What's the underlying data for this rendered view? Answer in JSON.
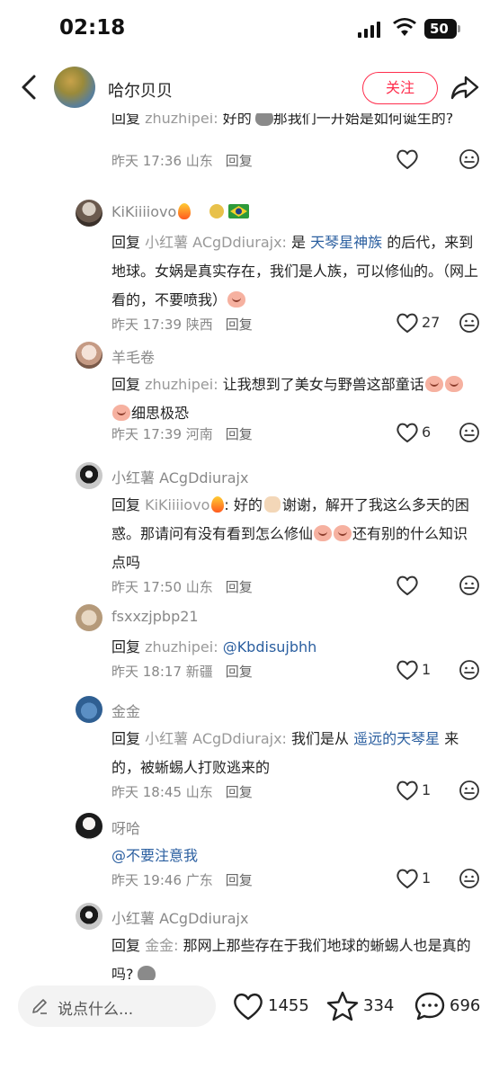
{
  "status_bar": {
    "time": "02:18",
    "battery": "50"
  },
  "header": {
    "title": "哈尔贝贝",
    "follow_label": "关注"
  },
  "comments": [
    {
      "continuation": true,
      "text_parts": [
        {
          "t": "回复 ",
          "c": ""
        },
        {
          "t": "zhuzhipei: ",
          "c": "at"
        },
        {
          "t": "好的",
          "c": ""
        },
        {
          "t": "那我们一开始是如何诞生的?",
          "c": ""
        }
      ],
      "time": "昨天 17:36",
      "location": "山东",
      "reply": "回复",
      "likes": ""
    },
    {
      "user": "KiKiiiiovo",
      "text_parts": [
        {
          "t": "回复 ",
          "c": ""
        },
        {
          "t": "小红薯 ACgDdiurajx: ",
          "c": "at"
        },
        {
          "t": "是 ",
          "c": ""
        },
        {
          "t": "天琴星神族",
          "c": "link"
        },
        {
          "t": " 的后代，来到地球。女娲是真实存在，我们是人族，可以修仙的。（网上看的，不要喷我）",
          "c": ""
        }
      ],
      "time": "昨天 17:39",
      "location": "陕西",
      "reply": "回复",
      "likes": "27"
    },
    {
      "user": "羊毛卷",
      "text_parts": [
        {
          "t": "回复 ",
          "c": ""
        },
        {
          "t": "zhuzhipei: ",
          "c": "at"
        },
        {
          "t": "让我想到了美女与野兽这部童话",
          "c": ""
        },
        {
          "t": "细思极恐",
          "c": ""
        }
      ],
      "time": "昨天 17:39",
      "location": "河南",
      "reply": "回复",
      "likes": "6"
    },
    {
      "user": "小红薯 ACgDdiurajx",
      "text_parts": [
        {
          "t": "回复 ",
          "c": ""
        },
        {
          "t": "KiKiiiiovo",
          "c": "at"
        },
        {
          "t": ": 好的",
          "c": ""
        },
        {
          "t": "谢谢，解开了我这么多天的困惑。那请问有没有看到怎么修仙",
          "c": ""
        },
        {
          "t": "还有别的什么知识点吗",
          "c": ""
        }
      ],
      "time": "昨天 17:50",
      "location": "山东",
      "reply": "回复",
      "likes": ""
    },
    {
      "user": "fsxxzjpbp21",
      "text_parts": [
        {
          "t": "回复 ",
          "c": ""
        },
        {
          "t": "zhuzhipei: ",
          "c": "at"
        },
        {
          "t": "@Kbdisujbhh",
          "c": "link"
        }
      ],
      "time": "昨天 18:17",
      "location": "新疆",
      "reply": "回复",
      "likes": "1"
    },
    {
      "user": "金金",
      "text_parts": [
        {
          "t": "回复 ",
          "c": ""
        },
        {
          "t": "小红薯 ACgDdiurajx: ",
          "c": "at"
        },
        {
          "t": "我们是从 ",
          "c": ""
        },
        {
          "t": "遥远的天琴星",
          "c": "link"
        },
        {
          "t": " 来的，被蜥蜴人打败逃来的",
          "c": ""
        }
      ],
      "time": "昨天 18:45",
      "location": "山东",
      "reply": "回复",
      "likes": "1"
    },
    {
      "user": "呀哈",
      "text_parts": [
        {
          "t": "@不要注意我",
          "c": "link"
        }
      ],
      "time": "昨天 19:46",
      "location": "广东",
      "reply": "回复",
      "likes": "1"
    },
    {
      "user": "小红薯 ACgDdiurajx",
      "text_parts": [
        {
          "t": "回复 ",
          "c": ""
        },
        {
          "t": "金金: ",
          "c": "at"
        },
        {
          "t": "那网上那些存在于我们地球的蜥蜴人也是真的吗?",
          "c": ""
        }
      ],
      "time": "",
      "location": "",
      "reply": "",
      "likes": ""
    }
  ],
  "bottom_bar": {
    "input_placeholder": "说点什么...",
    "likes": "1455",
    "collects": "334",
    "comments": "696"
  }
}
